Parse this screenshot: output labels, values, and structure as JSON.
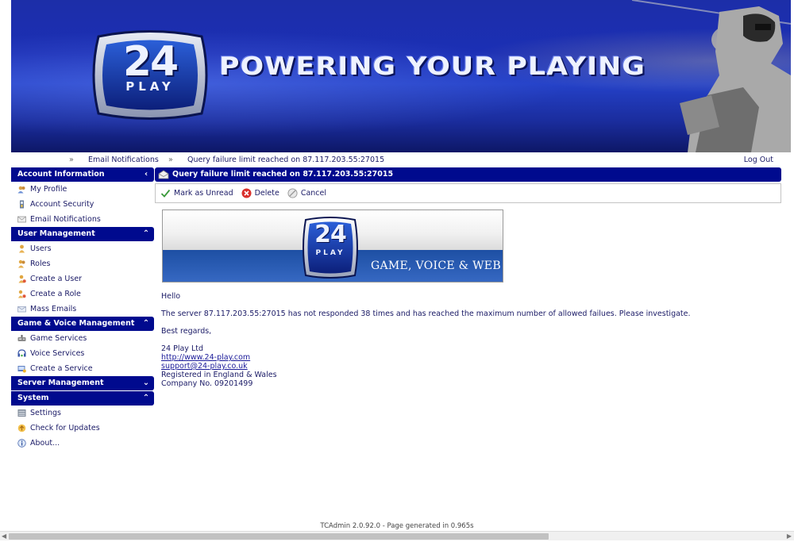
{
  "banner": {
    "logo_number": "24",
    "logo_word": "PLAY",
    "slogan": "POWERING YOUR PLAYING"
  },
  "topbar": {
    "sep": "»",
    "crumbs": [
      "Email Notifications",
      "Query failure limit reached on 87.117.203.55:27015"
    ],
    "logout": "Log Out"
  },
  "sidebar": {
    "sections": [
      {
        "title": "Account Information",
        "chevron": "‹",
        "items": [
          {
            "label": "My Profile",
            "icon": "profile-icon"
          },
          {
            "label": "Account Security",
            "icon": "security-icon"
          },
          {
            "label": "Email Notifications",
            "icon": "email-icon"
          }
        ]
      },
      {
        "title": "User Management",
        "chevron": "⌃",
        "items": [
          {
            "label": "Users",
            "icon": "users-icon"
          },
          {
            "label": "Roles",
            "icon": "roles-icon"
          },
          {
            "label": "Create a User",
            "icon": "create-user-icon"
          },
          {
            "label": "Create a Role",
            "icon": "create-role-icon"
          },
          {
            "label": "Mass Emails",
            "icon": "mass-email-icon"
          }
        ]
      },
      {
        "title": "Game & Voice Management",
        "chevron": "⌃",
        "items": [
          {
            "label": "Game Services",
            "icon": "game-services-icon"
          },
          {
            "label": "Voice Services",
            "icon": "voice-services-icon"
          },
          {
            "label": "Create a Service",
            "icon": "create-service-icon"
          }
        ]
      },
      {
        "title": "Server Management",
        "chevron": "⌄",
        "items": []
      },
      {
        "title": "System",
        "chevron": "⌃",
        "items": [
          {
            "label": "Settings",
            "icon": "settings-icon"
          },
          {
            "label": "Check for Updates",
            "icon": "updates-icon"
          },
          {
            "label": "About...",
            "icon": "about-icon"
          }
        ]
      }
    ]
  },
  "content": {
    "title": "Query failure limit reached on 87.117.203.55:27015",
    "toolbar": {
      "mark_unread": "Mark as Unread",
      "delete": "Delete",
      "cancel": "Cancel"
    },
    "image_tagline": "GAME, VOICE & WEB",
    "message": {
      "greeting": "Hello",
      "body": "The server 87.117.203.55:27015 has not responded 38 times and has reached the maximum number of allowed failues. Please investigate.",
      "signoff": "Best regards,",
      "company": "24 Play Ltd",
      "website": "http://www.24-play.com",
      "email": "support@24-play.co.uk",
      "registered": "Registered in England & Wales",
      "company_no": "Company No. 09201499"
    }
  },
  "footer": {
    "text": "TCAdmin 2.0.92.0 - Page generated in 0.965s"
  },
  "colors": {
    "nav_blue": "#000a8e",
    "text_navy": "#1a1a66",
    "banner_blue": "#1b2fb5"
  }
}
